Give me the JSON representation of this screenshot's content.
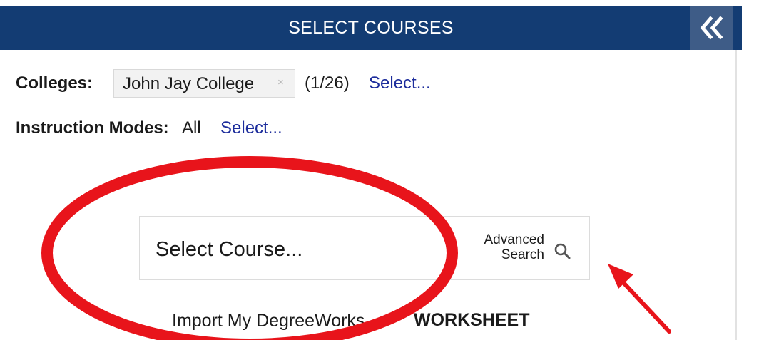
{
  "header": {
    "title": "SELECT COURSES",
    "collapse_icon": "double-chevron-left-icon",
    "background_color": "#133c73"
  },
  "filters": {
    "colleges_label": "Colleges:",
    "college_chip": "John Jay College",
    "chip_remove": "×",
    "college_count": "(1/26)",
    "colleges_select": "Select...",
    "modes_label": "Instruction Modes:",
    "modes_value": "All",
    "modes_select": "Select..."
  },
  "course_search": {
    "placeholder": "Select Course...",
    "advanced_search": "Advanced\nSearch",
    "search_icon": "search-icon"
  },
  "footer": {
    "import_text": "Import My DegreeWorks",
    "worksheet_text": "WORKSHEET"
  },
  "annotations": {
    "circle_color": "#e8141b",
    "arrow_color": "#e8141b"
  }
}
